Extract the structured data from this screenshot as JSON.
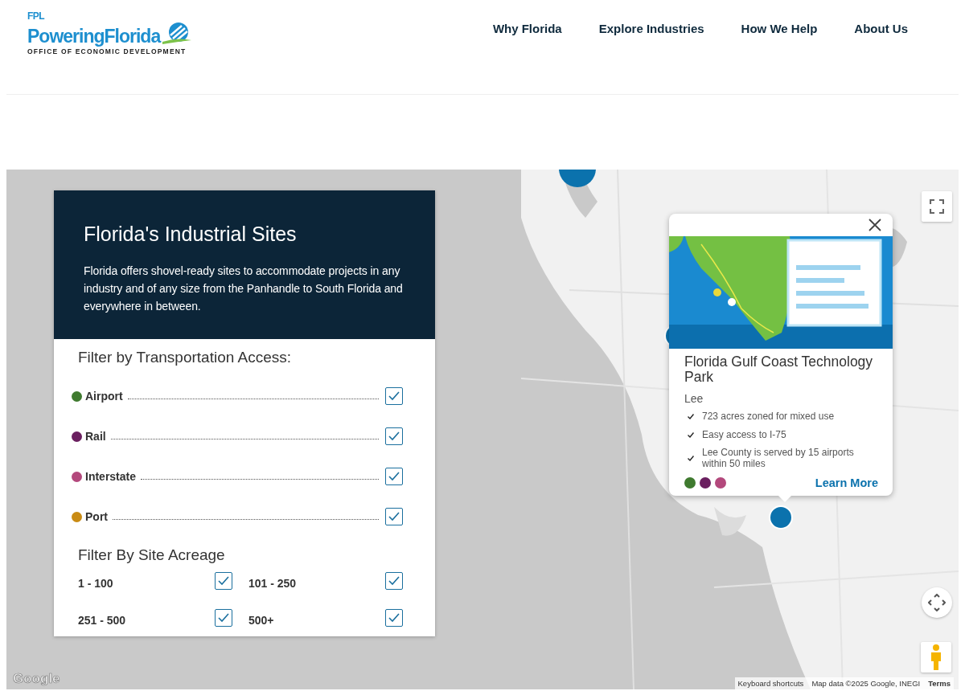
{
  "logo": {
    "brand": "FPL",
    "name": "PoweringFlorida",
    "tagline": "OFFICE OF ECONOMIC DEVELOPMENT"
  },
  "nav": [
    {
      "label": "Why Florida"
    },
    {
      "label": "Explore Industries"
    },
    {
      "label": "How We Help"
    },
    {
      "label": "About Us"
    }
  ],
  "panel": {
    "title": "Florida's Industrial Sites",
    "description": "Florida offers shovel-ready sites to accommodate projects in any industry and of any size from the Panhandle to South Florida and everywhere in between.",
    "transport_heading": "Filter by Transportation Access:",
    "transport_filters": [
      {
        "label": "Airport",
        "color": "#3f7a2f",
        "checked": true
      },
      {
        "label": "Rail",
        "color": "#6a1f5f",
        "checked": true
      },
      {
        "label": "Interstate",
        "color": "#b3487c",
        "checked": true
      },
      {
        "label": "Port",
        "color": "#c98b14",
        "checked": true
      }
    ],
    "acreage_heading": "Filter By Site Acreage",
    "acreage_filters": [
      {
        "label": "1 - 100",
        "checked": true
      },
      {
        "label": "101 - 250",
        "checked": true
      },
      {
        "label": "251 - 500",
        "checked": true
      },
      {
        "label": "500+",
        "checked": true
      }
    ]
  },
  "popup": {
    "image": {
      "kind": "picture"
    },
    "title": "Florida Gulf Coast Technology Park",
    "county": "Lee",
    "features": [
      "723 acres zoned for mixed use",
      "Easy access to I-75",
      "Lee County is served by 15 airports within 50 miles"
    ],
    "access_dots": [
      {
        "color": "#3f7a2f"
      },
      {
        "color": "#6a1f5f"
      },
      {
        "color": "#b3487c"
      }
    ],
    "link": "Learn More"
  },
  "map": {
    "logo": "Google",
    "attribution": [
      {
        "kind": "link",
        "text": "Keyboard shortcuts"
      },
      {
        "kind": "text",
        "text": "Map data ©2025 Google, INEGI"
      },
      {
        "kind": "bold",
        "text": "Terms"
      }
    ]
  }
}
